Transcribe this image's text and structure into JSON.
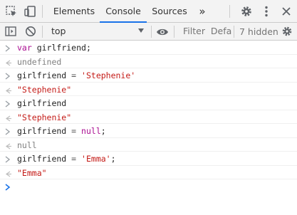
{
  "tabs": [
    "Elements",
    "Console",
    "Sources"
  ],
  "active_tab": "Console",
  "more_tabs": "»",
  "toolbar": {
    "context": "top",
    "filter_placeholder": "Filter",
    "levels_label": "Default levels",
    "hidden": "7 hidden"
  },
  "entries": [
    {
      "kind": "input",
      "parts": [
        {
          "t": "var",
          "c": "kw"
        },
        {
          "t": " girlfriend;",
          "c": "plain"
        }
      ]
    },
    {
      "kind": "output",
      "parts": [
        {
          "t": "undefined",
          "c": "gray"
        }
      ]
    },
    {
      "kind": "input",
      "parts": [
        {
          "t": "girlfriend ",
          "c": "plain"
        },
        {
          "t": "=",
          "c": "op"
        },
        {
          "t": " ",
          "c": "plain"
        },
        {
          "t": "'Stephenie'",
          "c": "str"
        }
      ]
    },
    {
      "kind": "output",
      "parts": [
        {
          "t": "\"Stephenie\"",
          "c": "strres"
        }
      ]
    },
    {
      "kind": "input",
      "parts": [
        {
          "t": "girlfriend",
          "c": "plain"
        }
      ]
    },
    {
      "kind": "output",
      "parts": [
        {
          "t": "\"Stephenie\"",
          "c": "strres"
        }
      ]
    },
    {
      "kind": "input",
      "parts": [
        {
          "t": "girlfriend ",
          "c": "plain"
        },
        {
          "t": "=",
          "c": "op"
        },
        {
          "t": " ",
          "c": "plain"
        },
        {
          "t": "null",
          "c": "kw"
        },
        {
          "t": ";",
          "c": "plain"
        }
      ]
    },
    {
      "kind": "output",
      "parts": [
        {
          "t": "null",
          "c": "gray"
        }
      ]
    },
    {
      "kind": "input",
      "parts": [
        {
          "t": "girlfriend ",
          "c": "plain"
        },
        {
          "t": "=",
          "c": "op"
        },
        {
          "t": " ",
          "c": "plain"
        },
        {
          "t": "'Emma'",
          "c": "str"
        },
        {
          "t": ";",
          "c": "plain"
        }
      ]
    },
    {
      "kind": "output",
      "parts": [
        {
          "t": "\"Emma\"",
          "c": "strres"
        }
      ]
    }
  ],
  "colors": {
    "accent": "#1a73e8",
    "prompt_arrow": "#1a73e8",
    "string": "#c41a16",
    "keyword": "#aa0d91"
  }
}
